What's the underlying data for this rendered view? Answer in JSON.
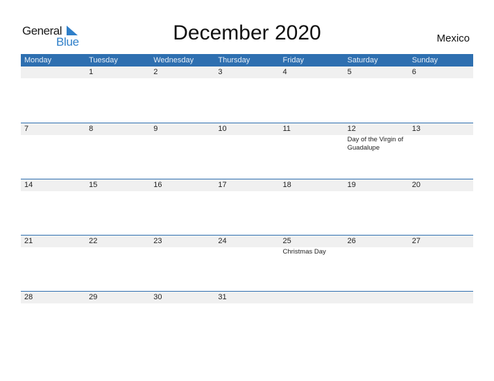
{
  "logo": {
    "line1": "General",
    "line2": "Blue",
    "brand_color": "#2f7fc9"
  },
  "title": "December 2020",
  "country": "Mexico",
  "colors": {
    "header_bg": "#2e6fb0",
    "date_strip_bg": "#f0f0f0",
    "week_divider": "#2e6fb0"
  },
  "weekdays": [
    "Monday",
    "Tuesday",
    "Wednesday",
    "Thursday",
    "Friday",
    "Saturday",
    "Sunday"
  ],
  "weeks": [
    [
      {
        "num": ""
      },
      {
        "num": "1"
      },
      {
        "num": "2"
      },
      {
        "num": "3"
      },
      {
        "num": "4"
      },
      {
        "num": "5"
      },
      {
        "num": "6"
      }
    ],
    [
      {
        "num": "7"
      },
      {
        "num": "8"
      },
      {
        "num": "9"
      },
      {
        "num": "10"
      },
      {
        "num": "11"
      },
      {
        "num": "12",
        "holiday": "Day of the Virgin of Guadalupe"
      },
      {
        "num": "13"
      }
    ],
    [
      {
        "num": "14"
      },
      {
        "num": "15"
      },
      {
        "num": "16"
      },
      {
        "num": "17"
      },
      {
        "num": "18"
      },
      {
        "num": "19"
      },
      {
        "num": "20"
      }
    ],
    [
      {
        "num": "21"
      },
      {
        "num": "22"
      },
      {
        "num": "23"
      },
      {
        "num": "24"
      },
      {
        "num": "25",
        "holiday": "Christmas Day"
      },
      {
        "num": "26"
      },
      {
        "num": "27"
      }
    ],
    [
      {
        "num": "28"
      },
      {
        "num": "29"
      },
      {
        "num": "30"
      },
      {
        "num": "31"
      },
      {
        "num": ""
      },
      {
        "num": ""
      },
      {
        "num": ""
      }
    ]
  ]
}
